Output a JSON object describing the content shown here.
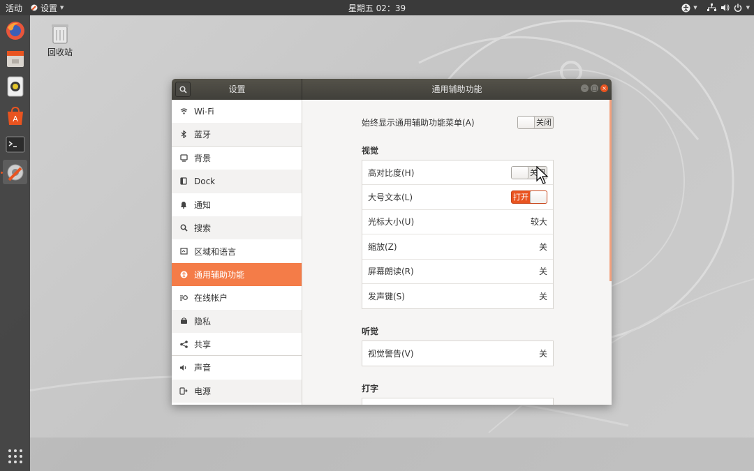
{
  "topbar": {
    "activities": "活动",
    "app_menu": "设置",
    "clock": "星期五 02：39"
  },
  "desktop": {
    "trash_label": "回收站"
  },
  "window": {
    "sidebar_title": "设置",
    "content_title": "通用辅助功能",
    "accent_color": "#e95420"
  },
  "sidebar": {
    "items": [
      {
        "label": "Wi-Fi",
        "icon": "wifi-icon"
      },
      {
        "label": "蓝牙",
        "icon": "bluetooth-icon"
      },
      {
        "label": "背景",
        "icon": "background-icon"
      },
      {
        "label": "Dock",
        "icon": "dock-icon"
      },
      {
        "label": "通知",
        "icon": "bell-icon"
      },
      {
        "label": "搜索",
        "icon": "search-icon"
      },
      {
        "label": "区域和语言",
        "icon": "flag-icon"
      },
      {
        "label": "通用辅助功能",
        "icon": "accessibility-icon",
        "selected": true
      },
      {
        "label": "在线帐户",
        "icon": "online-accounts-icon"
      },
      {
        "label": "隐私",
        "icon": "privacy-icon"
      },
      {
        "label": "共享",
        "icon": "share-icon"
      },
      {
        "label": "声音",
        "icon": "speaker-icon"
      },
      {
        "label": "电源",
        "icon": "power-icon"
      }
    ]
  },
  "content": {
    "always_show_menu": {
      "label": "始终显示通用辅助功能菜单(A)",
      "state": "关闭"
    },
    "vision": {
      "heading": "视觉",
      "rows": [
        {
          "label": "高对比度(H)",
          "switch": "关闭"
        },
        {
          "label": "大号文本(L)",
          "switch": "打开"
        },
        {
          "label": "光标大小(U)",
          "value": "较大"
        },
        {
          "label": "缩放(Z)",
          "value": "关"
        },
        {
          "label": "屏幕朗读(R)",
          "value": "关"
        },
        {
          "label": "发声键(S)",
          "value": "关"
        }
      ]
    },
    "hearing": {
      "heading": "听觉",
      "rows": [
        {
          "label": "视觉警告(V)",
          "value": "关"
        }
      ]
    },
    "typing": {
      "heading": "打字"
    }
  }
}
